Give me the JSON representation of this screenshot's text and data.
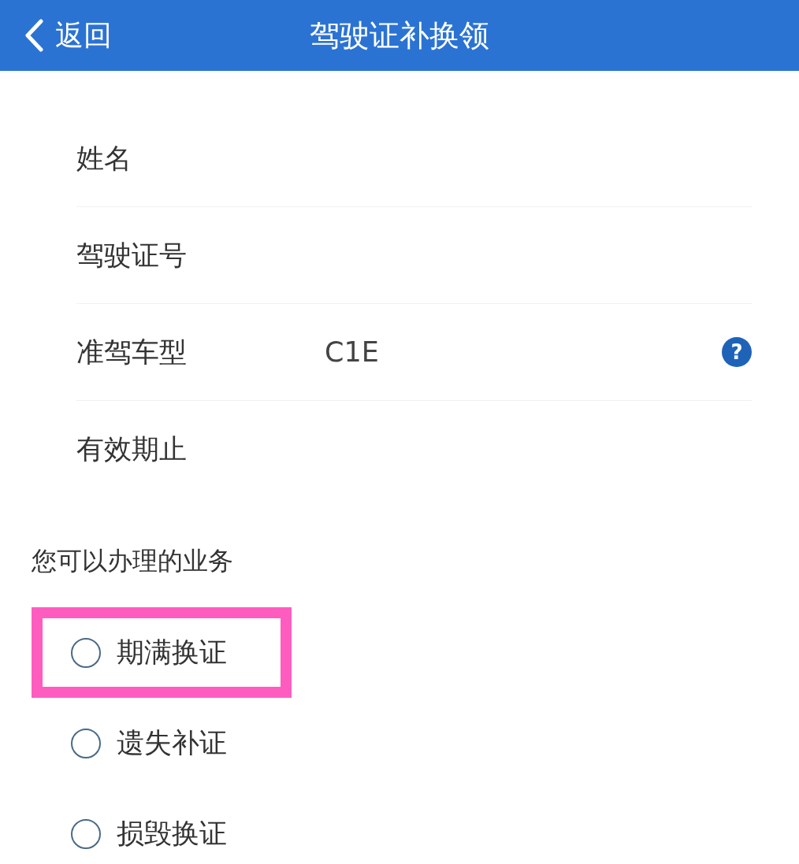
{
  "header": {
    "back_label": "返回",
    "title": "驾驶证补换领"
  },
  "fields": [
    {
      "label": "姓名"
    },
    {
      "label": "驾驶证号"
    },
    {
      "label": "准驾车型",
      "value": "C1E",
      "help": "?"
    },
    {
      "label": "有效期止"
    }
  ],
  "section_title": "您可以办理的业务",
  "options": [
    {
      "label": "期满换证",
      "selected": false,
      "highlighted": true
    },
    {
      "label": "遗失补证",
      "selected": false,
      "highlighted": false
    },
    {
      "label": "损毁换证",
      "selected": false,
      "highlighted": false
    }
  ]
}
